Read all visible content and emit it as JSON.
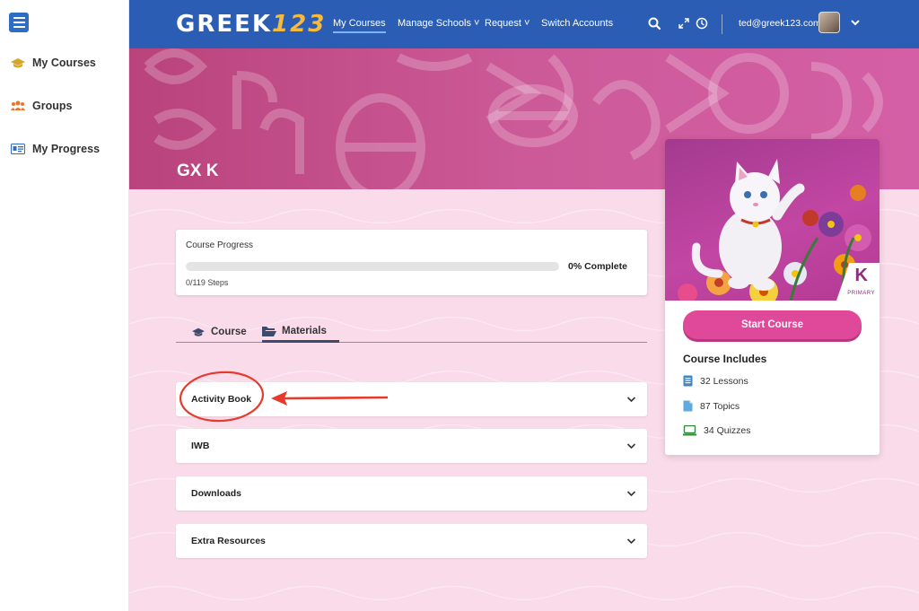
{
  "sidebar": {
    "toggle_icon": "hamburger-menu-icon",
    "items": [
      {
        "label": "My Courses",
        "icon": "graduation-cap-icon"
      },
      {
        "label": "Groups",
        "icon": "group-icon"
      },
      {
        "label": "My Progress",
        "icon": "id-card-icon"
      }
    ]
  },
  "topnav": {
    "logo_text": "GREEK",
    "logo_num": "123",
    "links": [
      {
        "label": "My Courses",
        "active": true
      },
      {
        "label": "Manage Schools ˅",
        "active": false
      },
      {
        "label": "Request ˅",
        "active": false
      },
      {
        "label": "Switch Accounts",
        "active": false
      }
    ],
    "user_email": "ted@greek123.com",
    "icons": [
      "search-icon",
      "expand-icon",
      "history-icon",
      "chevron-down-icon"
    ],
    "color": "#2a5db3"
  },
  "banner": {
    "title": "GX K",
    "color": "#c4528f"
  },
  "progress": {
    "label": "Course Progress",
    "percent": 0,
    "percent_text": "0% Complete",
    "steps": "0/119 Steps"
  },
  "tabs": [
    {
      "label": "Course",
      "icon": "graduation-cap-icon",
      "active": false
    },
    {
      "label": "Materials",
      "icon": "folder-open-icon",
      "active": true
    }
  ],
  "materials": [
    {
      "label": "Activity Book"
    },
    {
      "label": "IWB"
    },
    {
      "label": "Downloads"
    },
    {
      "label": "Extra Resources"
    }
  ],
  "course_card": {
    "badge_letter": "K",
    "badge_sub": "PRIMARY",
    "start_button": "Start Course",
    "includes_title": "Course Includes",
    "includes": [
      {
        "label": "32 Lessons",
        "icon": "lessons-icon"
      },
      {
        "label": "87 Topics",
        "icon": "topics-icon"
      },
      {
        "label": "34 Quizzes",
        "icon": "quizzes-icon"
      }
    ],
    "accent": "#e0489a"
  }
}
